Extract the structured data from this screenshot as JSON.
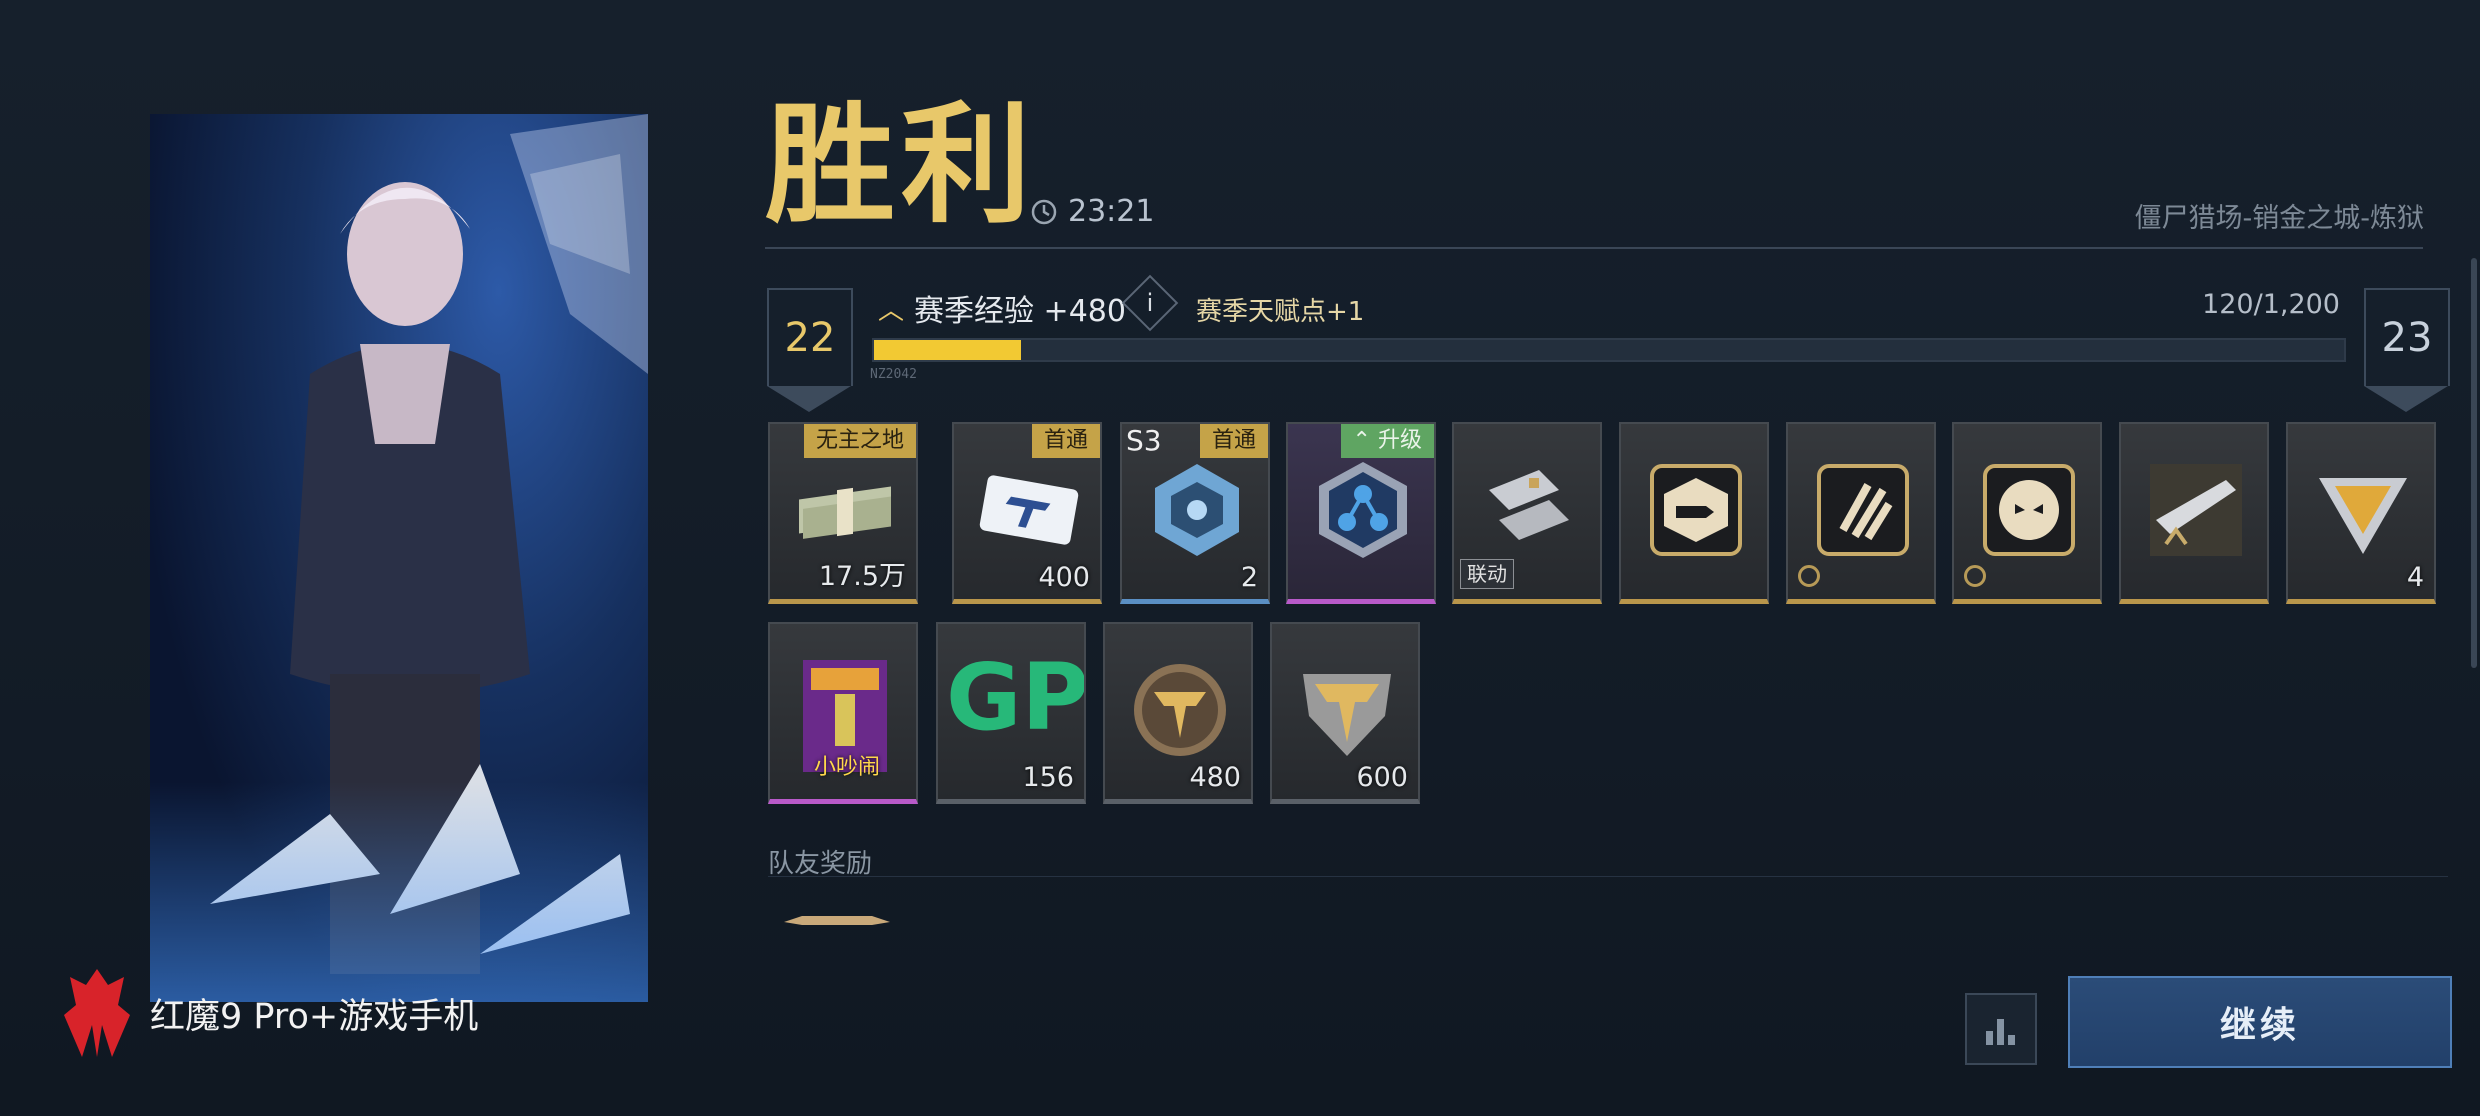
{
  "result": {
    "title": "胜利",
    "time": "23:21",
    "mode": "僵尸猎场-销金之城-炼狱"
  },
  "level": {
    "current": "22",
    "next": "23",
    "xp_label": "赛季经验 +480",
    "info": "i",
    "talent": "赛季天赋点+1",
    "xp_count": "120/1,200",
    "progress_fraction": 0.1,
    "tag": "NZ2042"
  },
  "rewards": {
    "row1": [
      {
        "name": "cash-bundle",
        "tag": "无主之地",
        "qty": "17.5万",
        "rarity": "gold"
      },
      {
        "name": "card-ticket",
        "tag": "首通",
        "qty": "400",
        "rarity": "gold"
      },
      {
        "name": "s3-crate",
        "tag": "首通",
        "badge": "S3",
        "qty": "2",
        "rarity": "blue"
      },
      {
        "name": "module-upgrade",
        "tag": "升级",
        "rarity": "purple"
      },
      {
        "name": "collab-gauntlets",
        "collab": "联动",
        "rarity": "gold"
      },
      {
        "name": "ammo-upgrade-talent",
        "rarity": "gold"
      },
      {
        "name": "claw-talent",
        "rarity": "gold"
      },
      {
        "name": "beast-talent",
        "rarity": "gold"
      },
      {
        "name": "weapon-blueprint",
        "rarity": "gold"
      },
      {
        "name": "triangle-core",
        "qty": "4",
        "rarity": "gold"
      }
    ],
    "row2": [
      {
        "name": "rage-card",
        "text": "小吵闹",
        "rarity": "purple"
      },
      {
        "name": "gp-points",
        "text": "GP",
        "qty": "156",
        "rarity": "gray"
      },
      {
        "name": "bronze-medal",
        "qty": "480",
        "rarity": "gray"
      },
      {
        "name": "battle-pass-emblem",
        "qty": "600",
        "rarity": "gray"
      }
    ]
  },
  "teammate": {
    "label": "队友奖励"
  },
  "brand": {
    "text": "红魔9 Pro+游戏手机"
  },
  "buttons": {
    "continue": "继续"
  },
  "colors": {
    "gold": "#e8c86a",
    "xp_fill": "#f2c933",
    "accent_blue": "#2b4c78"
  }
}
